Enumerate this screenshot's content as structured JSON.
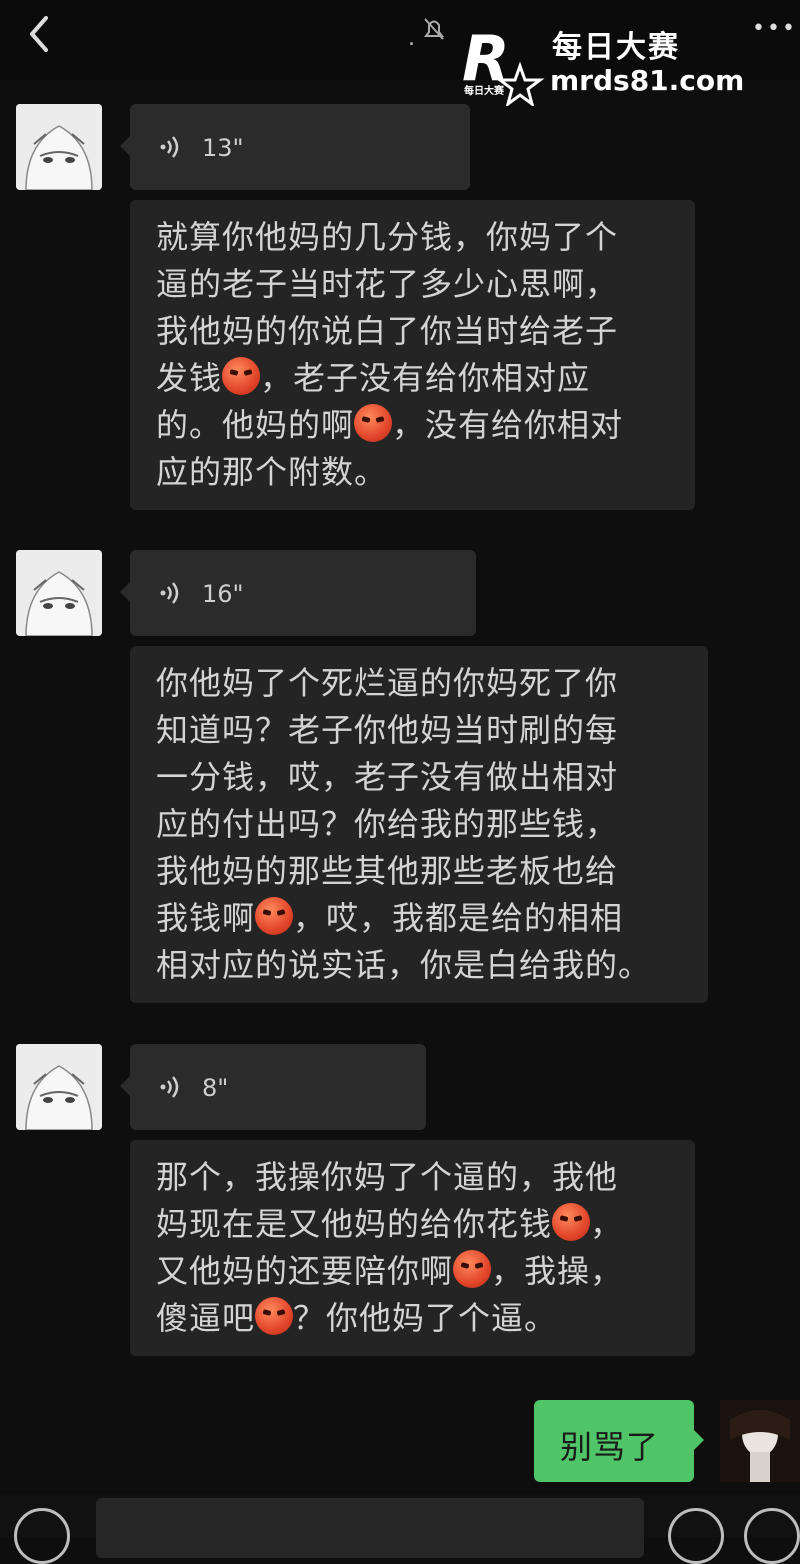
{
  "header": {
    "title_fragment": "."
  },
  "watermark": {
    "brand_cn": "每日大赛",
    "url": "mrds81.com",
    "logo_letter": "R",
    "logo_sub": "每日大赛"
  },
  "messages": [
    {
      "duration": "13\"",
      "lines": [
        "就算你他妈的几分钱，你妈了个",
        "逼的老子当时花了多少心思啊，",
        "我他妈的你说白了你当时给老子",
        [
          "发钱",
          "emoji",
          "，老子没有给你相对应"
        ],
        [
          "的。他妈的啊",
          "emoji",
          "，没有给你相对"
        ],
        "应的那个附数。"
      ]
    },
    {
      "duration": "16\"",
      "lines": [
        "你他妈了个死烂逼的你妈死了你",
        "知道吗？老子你他妈当时刷的每",
        "一分钱，哎，老子没有做出相对",
        "应的付出吗？你给我的那些钱，",
        "我他妈的那些其他那些老板也给",
        [
          "我钱啊",
          "emoji",
          "，哎，我都是给的相相"
        ],
        "相对应的说实话，你是白给我的。"
      ]
    },
    {
      "duration": "8\"",
      "lines": [
        "那个，我操你妈了个逼的，我他",
        [
          "妈现在是又他妈的给你花钱",
          "emoji",
          "，"
        ],
        [
          "又他妈的还要陪你啊",
          "emoji",
          "，我操，"
        ],
        [
          "傻逼吧",
          "emoji",
          "？你他妈了个逼。"
        ]
      ]
    }
  ],
  "reply": {
    "text": "别骂了"
  },
  "emoji_name": "angry-face-emoji"
}
